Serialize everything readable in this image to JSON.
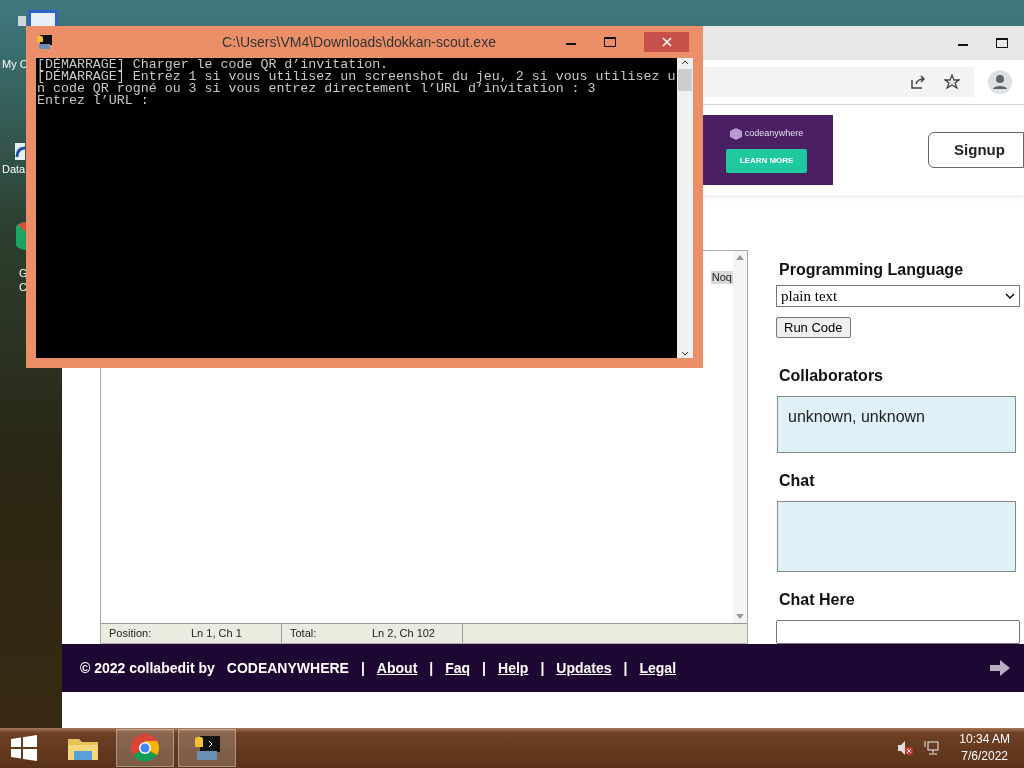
{
  "desktop": {
    "icons": [
      {
        "lines": [
          "My C"
        ]
      },
      {
        "lines": [
          "Data"
        ]
      },
      {
        "lines": [
          "G",
          "C"
        ]
      }
    ]
  },
  "console": {
    "title": "C:\\Users\\VM4\\Downloads\\dokkan-scout.exe",
    "lines": [
      "[DÉMARRAGE] Charger le code QR d’invitation.",
      "[DÉMARRAGE] Entrez 1 si vous utilisez un screenshot du jeu, 2 si vous utilisez u",
      "n code QR rogné ou 3 si vous entrez directement l’URL d’invitation : 3",
      "Entrez l’URL :"
    ]
  },
  "browser": {
    "ad": {
      "brand": "codeanywhere",
      "button": "LEARN MORE"
    },
    "signup": "Signup",
    "editor": {
      "visible_text": "Noq",
      "status": [
        {
          "label": "Position:",
          "value": "Ln 1, Ch 1"
        },
        {
          "label": "Total:",
          "value": "Ln 2, Ch 102"
        }
      ]
    },
    "sidebar": {
      "language_heading": "Programming Language",
      "language": "plain text",
      "run_button": "Run Code",
      "collaborators_heading": "Collaborators",
      "collaborators": "unknown, unknown",
      "chat_heading": "Chat",
      "chat_here_heading": "Chat Here"
    },
    "footer": [
      {
        "kind": "text",
        "text": "© 2022 collabedit by"
      },
      {
        "kind": "brand",
        "text": "CODEANYWHERE"
      },
      {
        "kind": "separator",
        "text": "|"
      },
      {
        "kind": "link",
        "text": "About"
      },
      {
        "kind": "separator",
        "text": "|"
      },
      {
        "kind": "link",
        "text": "Faq"
      },
      {
        "kind": "separator",
        "text": "|"
      },
      {
        "kind": "link",
        "text": "Help"
      },
      {
        "kind": "separator",
        "text": "|"
      },
      {
        "kind": "link",
        "text": "Updates"
      },
      {
        "kind": "separator",
        "text": "|"
      },
      {
        "kind": "link",
        "text": "Legal"
      }
    ]
  },
  "taskbar": {
    "apps": [
      {
        "kind": "explorer",
        "selected": false
      },
      {
        "kind": "chrome",
        "selected": true
      },
      {
        "kind": "console",
        "selected": true
      }
    ],
    "time": "10:34 AM",
    "date": "7/6/2022"
  }
}
